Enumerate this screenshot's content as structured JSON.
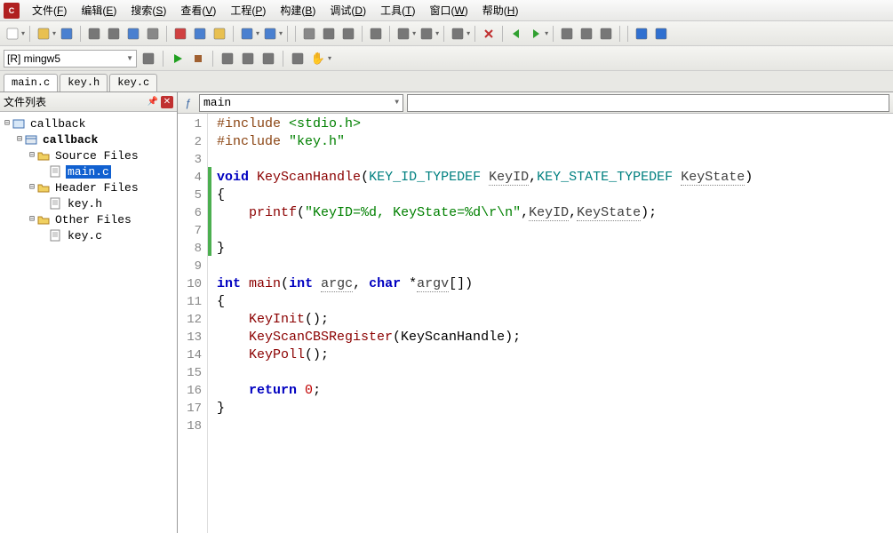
{
  "menu": {
    "items": [
      {
        "label": "文件",
        "key": "F"
      },
      {
        "label": "编辑",
        "key": "E"
      },
      {
        "label": "搜索",
        "key": "S"
      },
      {
        "label": "查看",
        "key": "V"
      },
      {
        "label": "工程",
        "key": "P"
      },
      {
        "label": "构建",
        "key": "B"
      },
      {
        "label": "调试",
        "key": "D"
      },
      {
        "label": "工具",
        "key": "T"
      },
      {
        "label": "窗口",
        "key": "W"
      },
      {
        "label": "帮助",
        "key": "H"
      }
    ]
  },
  "toolbar1_icons": [
    "new",
    "open",
    "save",
    "save-all",
    "save-as",
    "print",
    "cut",
    "copy",
    "paste",
    "undo",
    "redo",
    "find",
    "find-prev",
    "find-next",
    "find-in-files",
    "replace",
    "step-out",
    "step-in",
    "cancel",
    "back",
    "fwd",
    "bookmark",
    "next-bm",
    "clear-bm",
    "help",
    "info"
  ],
  "target": {
    "value": "[R] mingw5"
  },
  "toolbar2_icons": [
    "refresh",
    "run",
    "stop",
    "step-over",
    "step-into",
    "step-out2",
    "toggle-bp",
    "hand"
  ],
  "file_tabs": [
    {
      "label": "main.c",
      "active": true
    },
    {
      "label": "key.h",
      "active": false
    },
    {
      "label": "key.c",
      "active": false
    }
  ],
  "sidebar": {
    "title": "文件列表",
    "tree": {
      "root": "callback",
      "project": "callback",
      "folders": [
        {
          "name": "Source Files",
          "files": [
            "main.c"
          ]
        },
        {
          "name": "Header Files",
          "files": [
            "key.h"
          ]
        },
        {
          "name": "Other Files",
          "files": [
            "key.c"
          ]
        }
      ],
      "selected": "main.c"
    }
  },
  "editor": {
    "function_dropdown": "main",
    "lines": [
      {
        "n": 1,
        "segs": [
          {
            "t": "#include ",
            "c": "tok-pp"
          },
          {
            "t": "<stdio.h>",
            "c": "tok-inc"
          }
        ]
      },
      {
        "n": 2,
        "segs": [
          {
            "t": "#include ",
            "c": "tok-pp"
          },
          {
            "t": "\"key.h\"",
            "c": "tok-inc"
          }
        ]
      },
      {
        "n": 3,
        "segs": []
      },
      {
        "n": 4,
        "segs": [
          {
            "t": "void",
            "c": "tok-kw"
          },
          {
            "t": " ",
            "c": ""
          },
          {
            "t": "KeyScanHandle",
            "c": "tok-fn"
          },
          {
            "t": "(",
            "c": ""
          },
          {
            "t": "KEY_ID_TYPEDEF",
            "c": "tok-type"
          },
          {
            "t": " ",
            "c": ""
          },
          {
            "t": "KeyID",
            "c": "tok-var"
          },
          {
            "t": ",",
            "c": ""
          },
          {
            "t": "KEY_STATE_TYPEDEF",
            "c": "tok-type"
          },
          {
            "t": " ",
            "c": ""
          },
          {
            "t": "KeyState",
            "c": "tok-var"
          },
          {
            "t": ")",
            "c": ""
          }
        ]
      },
      {
        "n": 5,
        "segs": [
          {
            "t": "{",
            "c": ""
          }
        ]
      },
      {
        "n": 6,
        "segs": [
          {
            "t": "    ",
            "c": ""
          },
          {
            "t": "printf",
            "c": "tok-fn"
          },
          {
            "t": "(",
            "c": ""
          },
          {
            "t": "\"KeyID=%d, KeyState=%d\\r\\n\"",
            "c": "tok-str"
          },
          {
            "t": ",",
            "c": ""
          },
          {
            "t": "KeyID",
            "c": "tok-var"
          },
          {
            "t": ",",
            "c": ""
          },
          {
            "t": "KeyState",
            "c": "tok-var"
          },
          {
            "t": ");",
            "c": ""
          }
        ]
      },
      {
        "n": 7,
        "segs": []
      },
      {
        "n": 8,
        "segs": [
          {
            "t": "}",
            "c": ""
          }
        ]
      },
      {
        "n": 9,
        "segs": []
      },
      {
        "n": 10,
        "segs": [
          {
            "t": "int",
            "c": "tok-kw"
          },
          {
            "t": " ",
            "c": ""
          },
          {
            "t": "main",
            "c": "tok-fn"
          },
          {
            "t": "(",
            "c": ""
          },
          {
            "t": "int",
            "c": "tok-kw"
          },
          {
            "t": " ",
            "c": ""
          },
          {
            "t": "argc",
            "c": "tok-var"
          },
          {
            "t": ", ",
            "c": ""
          },
          {
            "t": "char",
            "c": "tok-kw"
          },
          {
            "t": " *",
            "c": ""
          },
          {
            "t": "argv",
            "c": "tok-var"
          },
          {
            "t": "[])",
            "c": ""
          }
        ]
      },
      {
        "n": 11,
        "segs": [
          {
            "t": "{",
            "c": ""
          }
        ]
      },
      {
        "n": 12,
        "segs": [
          {
            "t": "    ",
            "c": ""
          },
          {
            "t": "KeyInit",
            "c": "tok-fn"
          },
          {
            "t": "();",
            "c": ""
          }
        ]
      },
      {
        "n": 13,
        "segs": [
          {
            "t": "    ",
            "c": ""
          },
          {
            "t": "KeyScanCBSRegister",
            "c": "tok-fn"
          },
          {
            "t": "(KeyScanHandle);",
            "c": ""
          }
        ]
      },
      {
        "n": 14,
        "segs": [
          {
            "t": "    ",
            "c": ""
          },
          {
            "t": "KeyPoll",
            "c": "tok-fn"
          },
          {
            "t": "();",
            "c": ""
          }
        ]
      },
      {
        "n": 15,
        "segs": []
      },
      {
        "n": 16,
        "segs": [
          {
            "t": "    ",
            "c": ""
          },
          {
            "t": "return",
            "c": "tok-kw"
          },
          {
            "t": " ",
            "c": ""
          },
          {
            "t": "0",
            "c": "tok-num"
          },
          {
            "t": ";",
            "c": ""
          }
        ]
      },
      {
        "n": 17,
        "segs": [
          {
            "t": "}",
            "c": ""
          }
        ]
      },
      {
        "n": 18,
        "segs": []
      }
    ],
    "change_marks": [
      4,
      5,
      6,
      7,
      8
    ]
  }
}
